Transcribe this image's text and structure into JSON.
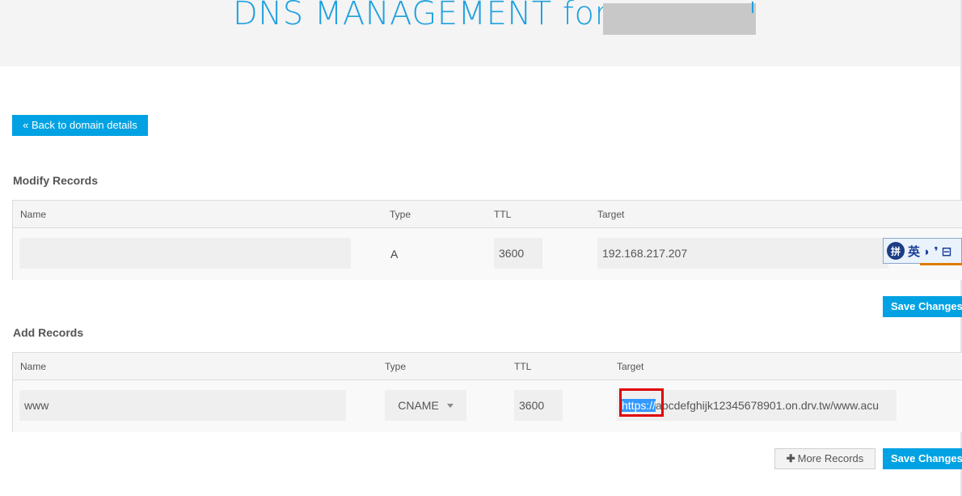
{
  "header": {
    "title": "DNS MANAGEMENT for a"
  },
  "back_button": {
    "label": "« Back to domain details"
  },
  "modify": {
    "title": "Modify Records",
    "columns": [
      "Name",
      "Type",
      "TTL",
      "Target"
    ],
    "rows": [
      {
        "name": "",
        "type": "A",
        "ttl": "3600",
        "target": "192.168.217.207"
      }
    ],
    "save_label": "Save Changes"
  },
  "add": {
    "title": "Add Records",
    "columns": [
      "Name",
      "Type",
      "TTL",
      "Target"
    ],
    "row": {
      "name": "www",
      "type": "CNAME",
      "ttl": "3600",
      "target_selected": "https://",
      "target_rest": "abcdefghijk12345678901.on.drv.tw/www.acu"
    },
    "more_label": "More Records",
    "save_label": "Save Changes"
  },
  "ime_toolbar": {
    "logo": "拼",
    "text": "英 ◗ ❜ ⊟"
  },
  "colors": {
    "accent": "#1ea1de",
    "button": "#00a2e3",
    "highlight": "#3399ff",
    "annotation": "#e00000"
  }
}
